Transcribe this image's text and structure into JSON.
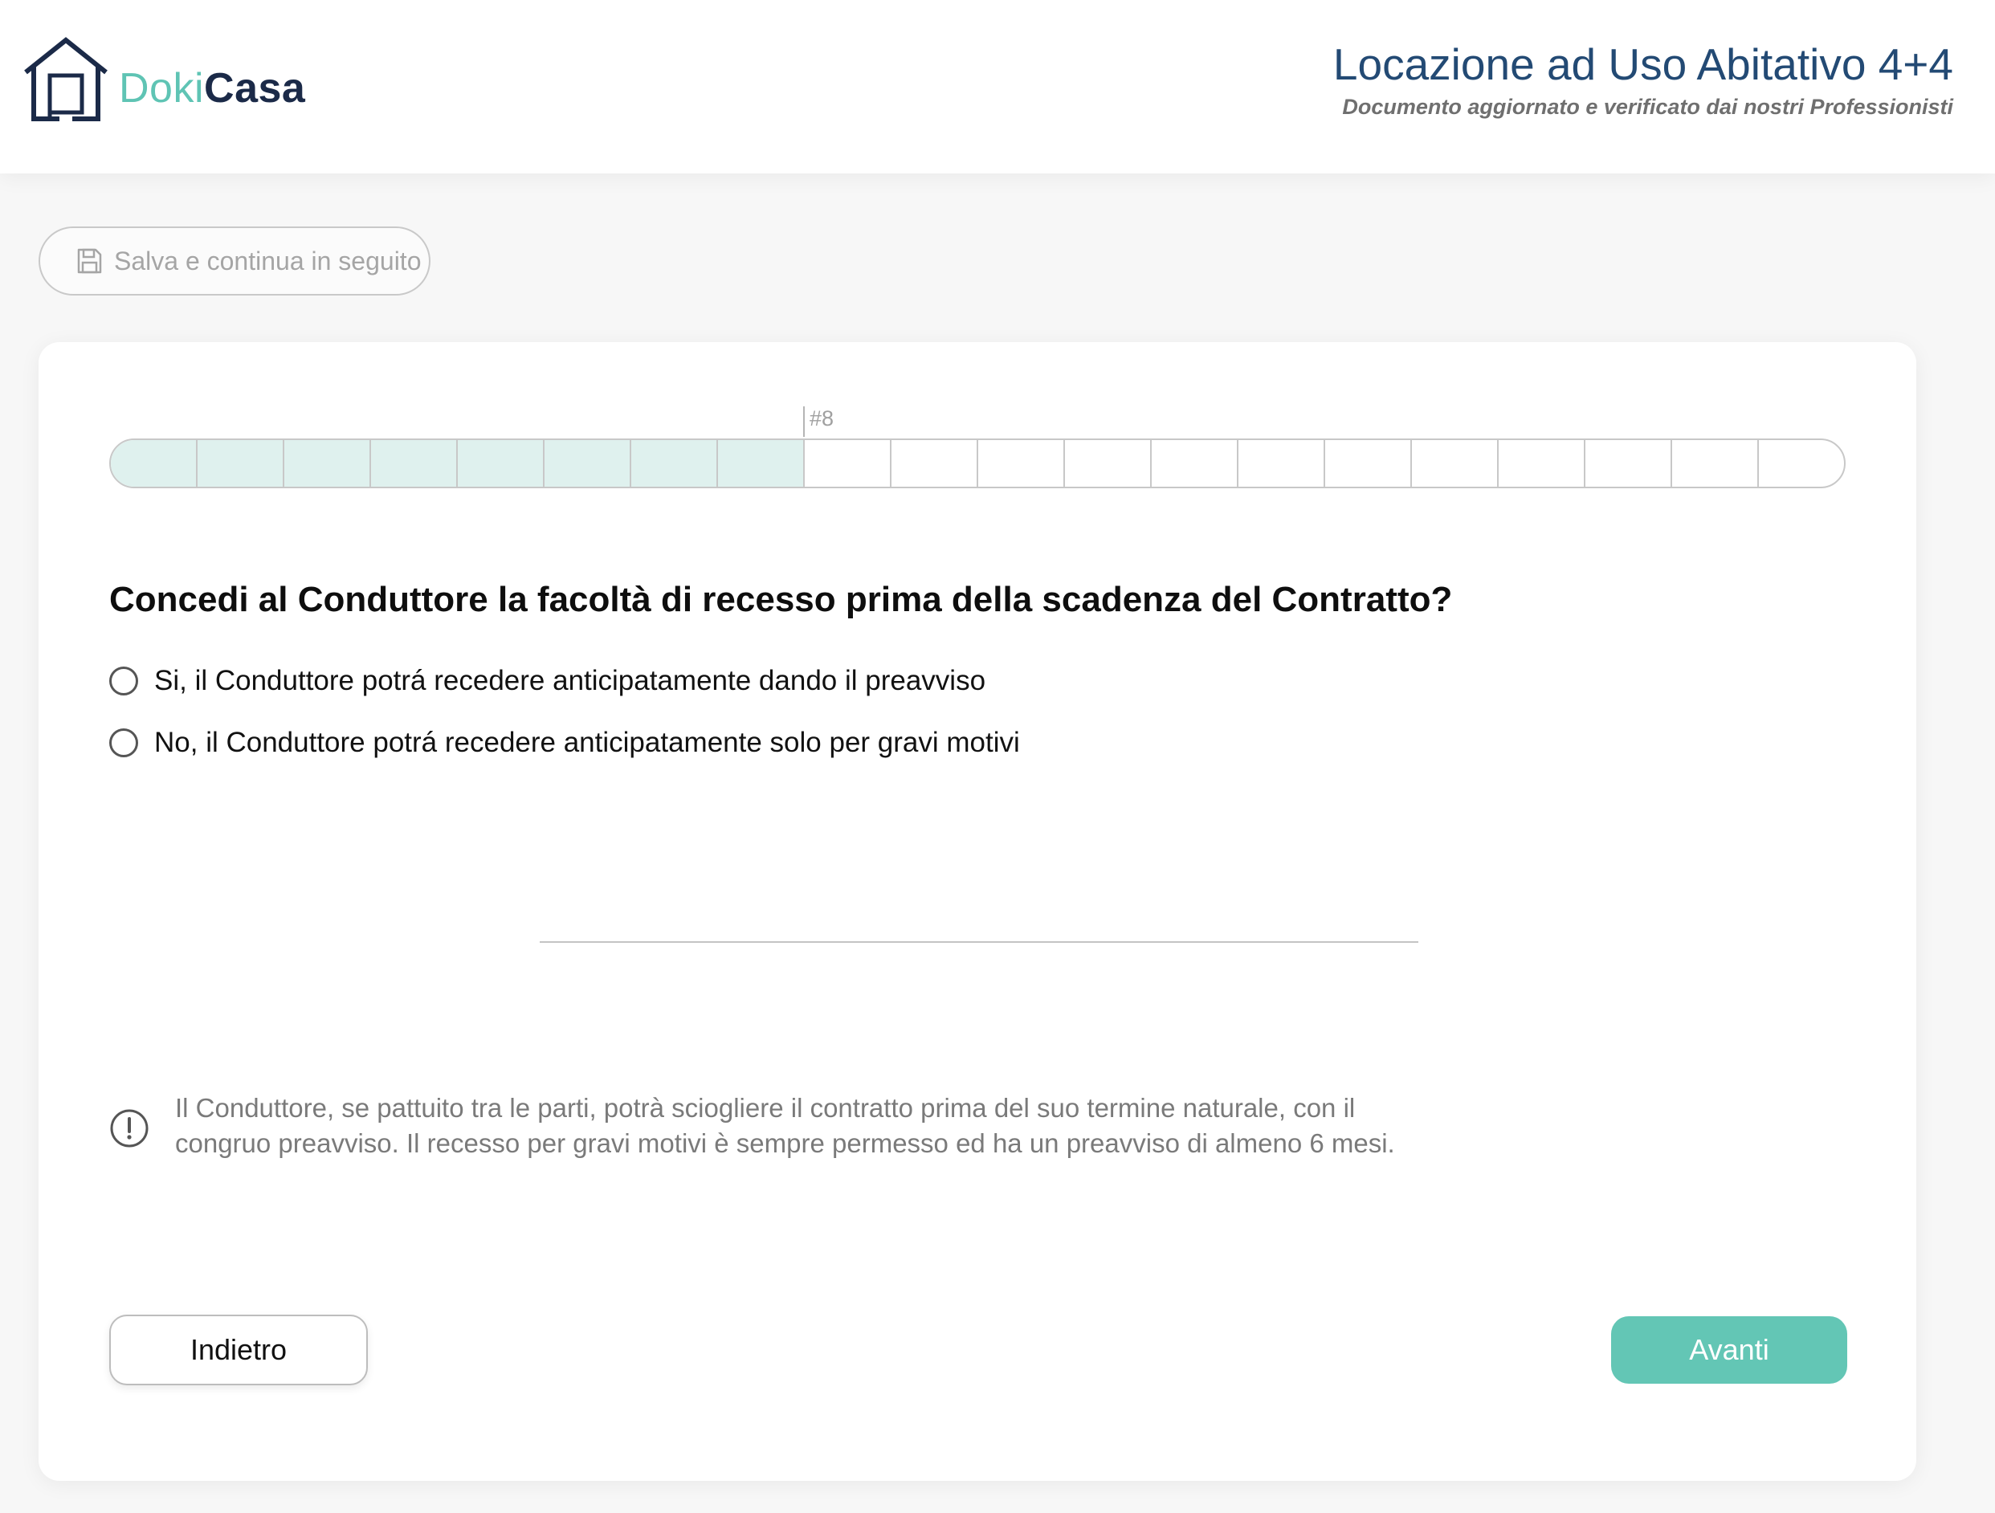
{
  "header": {
    "logo_part1": "Doki",
    "logo_part2": "Casa",
    "title": "Locazione ad Uso Abitativo 4+4",
    "subtitle": "Documento aggiornato e verificato dai nostri Professionisti"
  },
  "toolbar": {
    "save_label": "Salva e continua in seguito"
  },
  "progress": {
    "current_label": "#8",
    "completed_steps": 8,
    "total_steps": 20
  },
  "question": {
    "text": "Concedi al Conduttore la facoltà di recesso prima della scadenza del Contratto?",
    "options": [
      {
        "label": "Si, il Conduttore potrá recedere anticipatamente dando il preavviso"
      },
      {
        "label": "No, il Conduttore potrá recedere anticipatamente solo per gravi motivi"
      }
    ]
  },
  "hint": {
    "text": "Il Conduttore, se pattuito tra le parti, potrà sciogliere il contratto prima del suo termine naturale, con il congruo preavviso. Il recesso per gravi motivi è sempre permesso ed ha un preavviso di almeno 6 mesi."
  },
  "navigation": {
    "back_label": "Indietro",
    "next_label": "Avanti"
  },
  "colors": {
    "accent": "#63c6b5",
    "progress_done": "#dff1ee",
    "title_blue": "#234a74",
    "logo_dark": "#1b2a48"
  }
}
